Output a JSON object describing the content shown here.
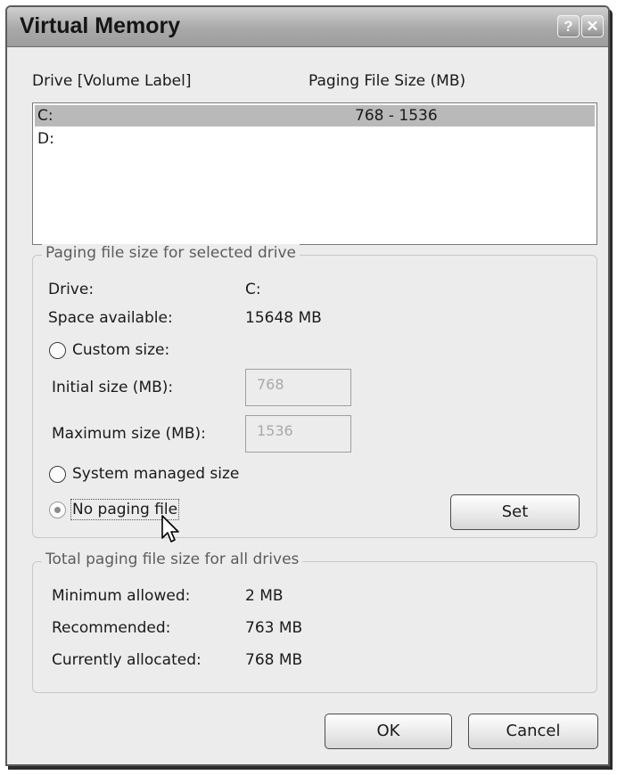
{
  "window": {
    "title": "Virtual Memory",
    "help_glyph": "?",
    "close_glyph": "✕"
  },
  "drive_list": {
    "header_drive": "Drive",
    "header_volume": "[Volume Label]",
    "header_size": "Paging File Size (MB)",
    "rows": [
      {
        "drive": "C:",
        "size": "768 - 1536",
        "selected": true
      },
      {
        "drive": "D:",
        "size": "",
        "selected": false
      }
    ]
  },
  "selected_drive": {
    "legend": "Paging file size for selected drive",
    "drive_label": "Drive:",
    "drive_value": "C:",
    "space_label": "Space available:",
    "space_value": "15648 MB",
    "custom_size_label": "Custom size:",
    "initial_label": "Initial size (MB):",
    "initial_value": "768",
    "maximum_label": "Maximum size (MB):",
    "maximum_value": "1536",
    "system_managed_label": "System managed size",
    "no_paging_label": "No paging file",
    "selected_option": "No paging file",
    "set_button": "Set"
  },
  "totals": {
    "legend": "Total paging file size for all drives",
    "minimum_label": "Minimum allowed:",
    "minimum_value": "2 MB",
    "recommended_label": "Recommended:",
    "recommended_value": "763 MB",
    "allocated_label": "Currently allocated:",
    "allocated_value": "768 MB"
  },
  "footer": {
    "ok_button": "OK",
    "cancel_button": "Cancel"
  },
  "icons": {
    "cursor": "mouse-pointer-icon"
  }
}
